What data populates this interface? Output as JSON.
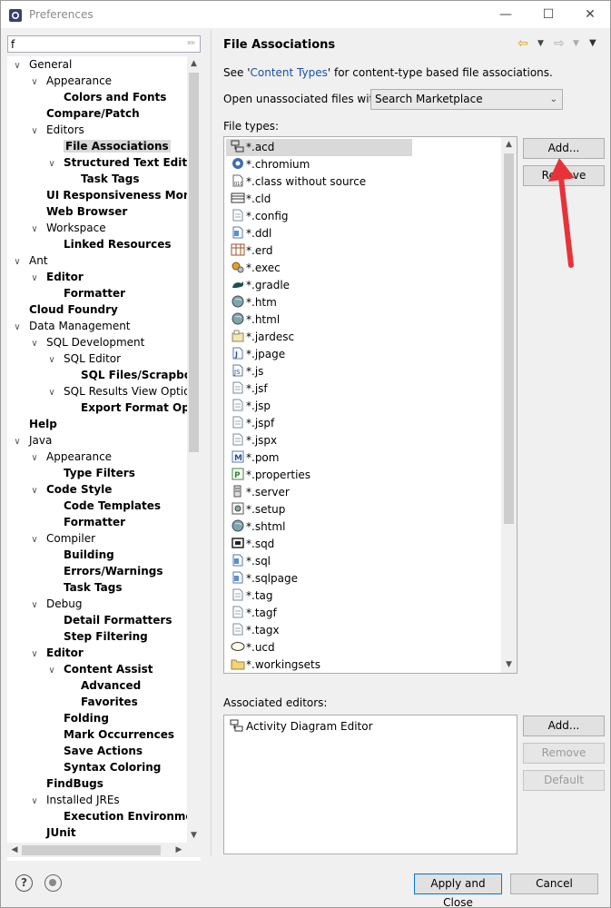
{
  "window": {
    "title": "Preferences"
  },
  "filter": {
    "value": "f"
  },
  "tree": [
    {
      "label": "General",
      "level": 0,
      "toggle": "open",
      "bold": false
    },
    {
      "label": "Appearance",
      "level": 1,
      "toggle": "open",
      "bold": false
    },
    {
      "label": "Colors and Fonts",
      "level": 2,
      "toggle": "none",
      "bold": true
    },
    {
      "label": "Compare/Patch",
      "level": 1,
      "toggle": "none",
      "bold": true
    },
    {
      "label": "Editors",
      "level": 1,
      "toggle": "open",
      "bold": false
    },
    {
      "label": "File Associations",
      "level": 2,
      "toggle": "none",
      "bold": true,
      "selected": true
    },
    {
      "label": "Structured Text Editors",
      "level": 2,
      "toggle": "open",
      "bold": true
    },
    {
      "label": "Task Tags",
      "level": 3,
      "toggle": "none",
      "bold": true
    },
    {
      "label": "UI Responsiveness Monito",
      "level": 1,
      "toggle": "none",
      "bold": true
    },
    {
      "label": "Web Browser",
      "level": 1,
      "toggle": "none",
      "bold": true
    },
    {
      "label": "Workspace",
      "level": 1,
      "toggle": "open",
      "bold": false
    },
    {
      "label": "Linked Resources",
      "level": 2,
      "toggle": "none",
      "bold": true
    },
    {
      "label": "Ant",
      "level": 0,
      "toggle": "open",
      "bold": false
    },
    {
      "label": "Editor",
      "level": 1,
      "toggle": "open",
      "bold": true
    },
    {
      "label": "Formatter",
      "level": 2,
      "toggle": "none",
      "bold": true
    },
    {
      "label": "Cloud Foundry",
      "level": 0,
      "toggle": "none",
      "bold": true
    },
    {
      "label": "Data Management",
      "level": 0,
      "toggle": "open",
      "bold": false
    },
    {
      "label": "SQL Development",
      "level": 1,
      "toggle": "open",
      "bold": false
    },
    {
      "label": "SQL Editor",
      "level": 2,
      "toggle": "open",
      "bold": false
    },
    {
      "label": "SQL Files/Scrapbook",
      "level": 3,
      "toggle": "none",
      "bold": true
    },
    {
      "label": "SQL Results View Option",
      "level": 2,
      "toggle": "open",
      "bold": false
    },
    {
      "label": "Export Format Optic",
      "level": 3,
      "toggle": "none",
      "bold": true
    },
    {
      "label": "Help",
      "level": 0,
      "toggle": "none",
      "bold": true
    },
    {
      "label": "Java",
      "level": 0,
      "toggle": "open",
      "bold": false
    },
    {
      "label": "Appearance",
      "level": 1,
      "toggle": "open",
      "bold": false
    },
    {
      "label": "Type Filters",
      "level": 2,
      "toggle": "none",
      "bold": true
    },
    {
      "label": "Code Style",
      "level": 1,
      "toggle": "open",
      "bold": true
    },
    {
      "label": "Code Templates",
      "level": 2,
      "toggle": "none",
      "bold": true
    },
    {
      "label": "Formatter",
      "level": 2,
      "toggle": "none",
      "bold": true
    },
    {
      "label": "Compiler",
      "level": 1,
      "toggle": "open",
      "bold": false
    },
    {
      "label": "Building",
      "level": 2,
      "toggle": "none",
      "bold": true
    },
    {
      "label": "Errors/Warnings",
      "level": 2,
      "toggle": "none",
      "bold": true
    },
    {
      "label": "Task Tags",
      "level": 2,
      "toggle": "none",
      "bold": true
    },
    {
      "label": "Debug",
      "level": 1,
      "toggle": "open",
      "bold": false
    },
    {
      "label": "Detail Formatters",
      "level": 2,
      "toggle": "none",
      "bold": true
    },
    {
      "label": "Step Filtering",
      "level": 2,
      "toggle": "none",
      "bold": true
    },
    {
      "label": "Editor",
      "level": 1,
      "toggle": "open",
      "bold": true
    },
    {
      "label": "Content Assist",
      "level": 2,
      "toggle": "open",
      "bold": true
    },
    {
      "label": "Advanced",
      "level": 3,
      "toggle": "none",
      "bold": true
    },
    {
      "label": "Favorites",
      "level": 3,
      "toggle": "none",
      "bold": true
    },
    {
      "label": "Folding",
      "level": 2,
      "toggle": "none",
      "bold": true
    },
    {
      "label": "Mark Occurrences",
      "level": 2,
      "toggle": "none",
      "bold": true
    },
    {
      "label": "Save Actions",
      "level": 2,
      "toggle": "none",
      "bold": true
    },
    {
      "label": "Syntax Coloring",
      "level": 2,
      "toggle": "none",
      "bold": true
    },
    {
      "label": "FindBugs",
      "level": 1,
      "toggle": "none",
      "bold": true
    },
    {
      "label": "Installed JREs",
      "level": 1,
      "toggle": "open",
      "bold": false
    },
    {
      "label": "Execution Environments",
      "level": 2,
      "toggle": "none",
      "bold": true
    },
    {
      "label": "JUnit",
      "level": 1,
      "toggle": "none",
      "bold": true
    }
  ],
  "page": {
    "title": "File Associations",
    "see_prefix": "See '",
    "see_link": "Content Types",
    "see_suffix": "' for content-type based file associations.",
    "open_label": "Open unassociated files with:",
    "open_value": "Search Marketplace",
    "filetypes_label": "File types:",
    "assoc_label": "Associated editors:"
  },
  "file_types": [
    {
      "name": "*.acd",
      "icon": "activity-diagram-icon",
      "selected": true
    },
    {
      "name": "*.chromium",
      "icon": "chromium-icon"
    },
    {
      "name": "*.class without source",
      "icon": "class-file-icon"
    },
    {
      "name": "*.cld",
      "icon": "cld-icon"
    },
    {
      "name": "*.config",
      "icon": "text-file-icon"
    },
    {
      "name": "*.ddl",
      "icon": "sql-file-icon"
    },
    {
      "name": "*.erd",
      "icon": "table-icon"
    },
    {
      "name": "*.exec",
      "icon": "gears-icon"
    },
    {
      "name": "*.gradle",
      "icon": "gradle-icon"
    },
    {
      "name": "*.htm",
      "icon": "globe-icon"
    },
    {
      "name": "*.html",
      "icon": "globe-icon"
    },
    {
      "name": "*.jardesc",
      "icon": "jar-icon"
    },
    {
      "name": "*.jpage",
      "icon": "jpage-icon"
    },
    {
      "name": "*.js",
      "icon": "js-file-icon"
    },
    {
      "name": "*.jsf",
      "icon": "text-file-icon"
    },
    {
      "name": "*.jsp",
      "icon": "text-file-icon"
    },
    {
      "name": "*.jspf",
      "icon": "text-file-icon"
    },
    {
      "name": "*.jspx",
      "icon": "text-file-icon"
    },
    {
      "name": "*.pom",
      "icon": "maven-icon"
    },
    {
      "name": "*.properties",
      "icon": "properties-icon"
    },
    {
      "name": "*.server",
      "icon": "server-icon"
    },
    {
      "name": "*.setup",
      "icon": "setup-icon"
    },
    {
      "name": "*.shtml",
      "icon": "globe-icon"
    },
    {
      "name": "*.sqd",
      "icon": "sqd-icon"
    },
    {
      "name": "*.sql",
      "icon": "sql-file-icon"
    },
    {
      "name": "*.sqlpage",
      "icon": "sql-file-icon"
    },
    {
      "name": "*.tag",
      "icon": "text-file-icon"
    },
    {
      "name": "*.tagf",
      "icon": "text-file-icon"
    },
    {
      "name": "*.tagx",
      "icon": "text-file-icon"
    },
    {
      "name": "*.ucd",
      "icon": "ucd-icon"
    },
    {
      "name": "*.workingsets",
      "icon": "folder-icon"
    }
  ],
  "associated_editors": [
    {
      "name": "Activity Diagram Editor",
      "icon": "activity-diagram-icon"
    }
  ],
  "buttons": {
    "file_add": "Add...",
    "file_remove": "Remove",
    "editor_add": "Add...",
    "editor_remove": "Remove",
    "editor_default": "Default",
    "apply_close": "Apply and Close",
    "cancel": "Cancel"
  },
  "colors": {
    "link": "#1a4fa3",
    "arrow": "#e8323a",
    "accent": "#0078d7"
  }
}
